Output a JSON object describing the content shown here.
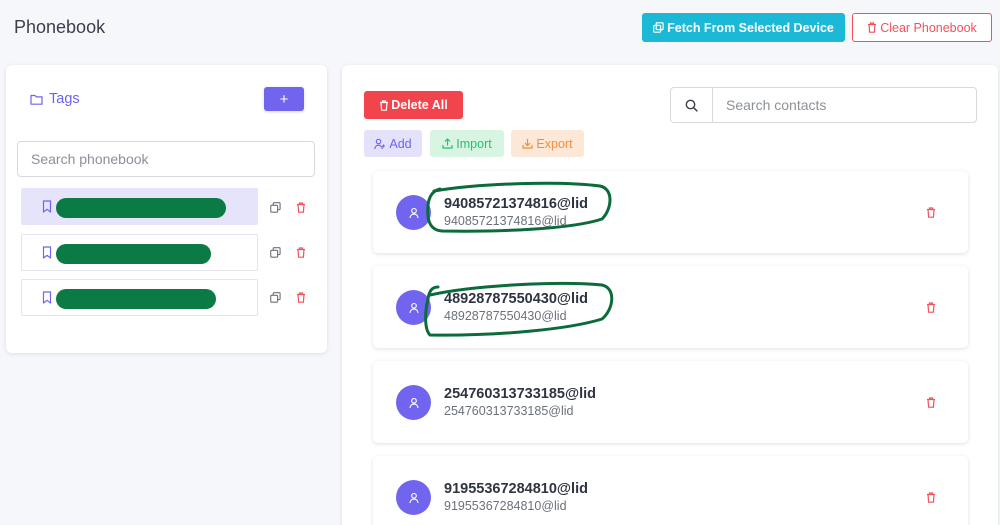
{
  "header": {
    "title": "Phonebook",
    "fetch_label": "Fetch From Selected Device",
    "clear_label": "Clear Phonebook"
  },
  "tags_panel": {
    "title": "Tags",
    "add_label": "+",
    "search_placeholder": "Search phonebook",
    "items": [
      {
        "label": "",
        "selected": true,
        "redacted": true
      },
      {
        "label": "",
        "selected": false,
        "redacted": true
      },
      {
        "label": "",
        "selected": false,
        "redacted": true
      }
    ]
  },
  "contacts_panel": {
    "delete_all_label": "Delete All",
    "search_placeholder": "Search contacts",
    "add_label": "Add",
    "import_label": "Import",
    "export_label": "Export",
    "contacts": [
      {
        "name": "94085721374816@lid",
        "number": "94085721374816@lid",
        "circled": true
      },
      {
        "name": "48928787550430@lid",
        "number": "48928787550430@lid",
        "circled": true
      },
      {
        "name": "254760313733185@lid",
        "number": "254760313733185@lid",
        "circled": false
      },
      {
        "name": "91955367284810@lid",
        "number": "91955367284810@lid",
        "circled": false
      }
    ]
  },
  "colors": {
    "primary": "#7165f0",
    "info": "#1bb9d6",
    "danger": "#f2444d",
    "success": "#2bbf6a",
    "warning": "#f58c3a",
    "redaction": "#0b7a44"
  }
}
